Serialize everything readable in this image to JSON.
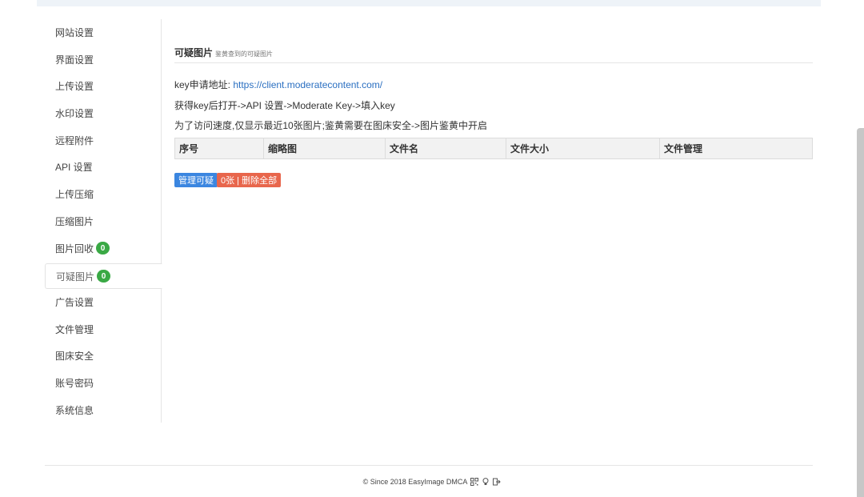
{
  "sidebar": {
    "items": [
      {
        "label": "网站设置"
      },
      {
        "label": "界面设置"
      },
      {
        "label": "上传设置"
      },
      {
        "label": "水印设置"
      },
      {
        "label": "远程附件"
      },
      {
        "label": "API 设置"
      },
      {
        "label": "上传压缩"
      },
      {
        "label": "压缩图片"
      },
      {
        "label": "图片回收",
        "badge": "0"
      },
      {
        "label": "可疑图片",
        "badge": "0",
        "active": true
      },
      {
        "label": "广告设置"
      },
      {
        "label": "文件管理"
      },
      {
        "label": "图床安全"
      },
      {
        "label": "账号密码"
      },
      {
        "label": "系统信息"
      }
    ]
  },
  "main": {
    "title": "可疑图片",
    "subtitle": "鉴黄查到的可疑图片",
    "key_prefix": "key申请地址: ",
    "key_url": "https://client.moderatecontent.com/",
    "instruction": "获得key后打开->API 设置->Moderate Key->填入key",
    "note": "为了访问速度,仅显示最近10张图片;鉴黄需要在图床安全->图片鉴黄中开启",
    "table_headers": [
      "序号",
      "缩略图",
      "文件名",
      "文件大小",
      "文件管理"
    ],
    "btn_manage": "管理可疑",
    "btn_delete": "0张 | 删除全部"
  },
  "footer": {
    "text": "© Since 2018 EasyImage DMCA",
    "icons": [
      "qrcode-icon",
      "lightbulb-icon",
      "logout-icon"
    ]
  },
  "colors": {
    "badge_green": "#3aa945",
    "btn_blue": "#3b86e0",
    "btn_red": "#e8664c",
    "link_blue": "#2a6fc1"
  }
}
